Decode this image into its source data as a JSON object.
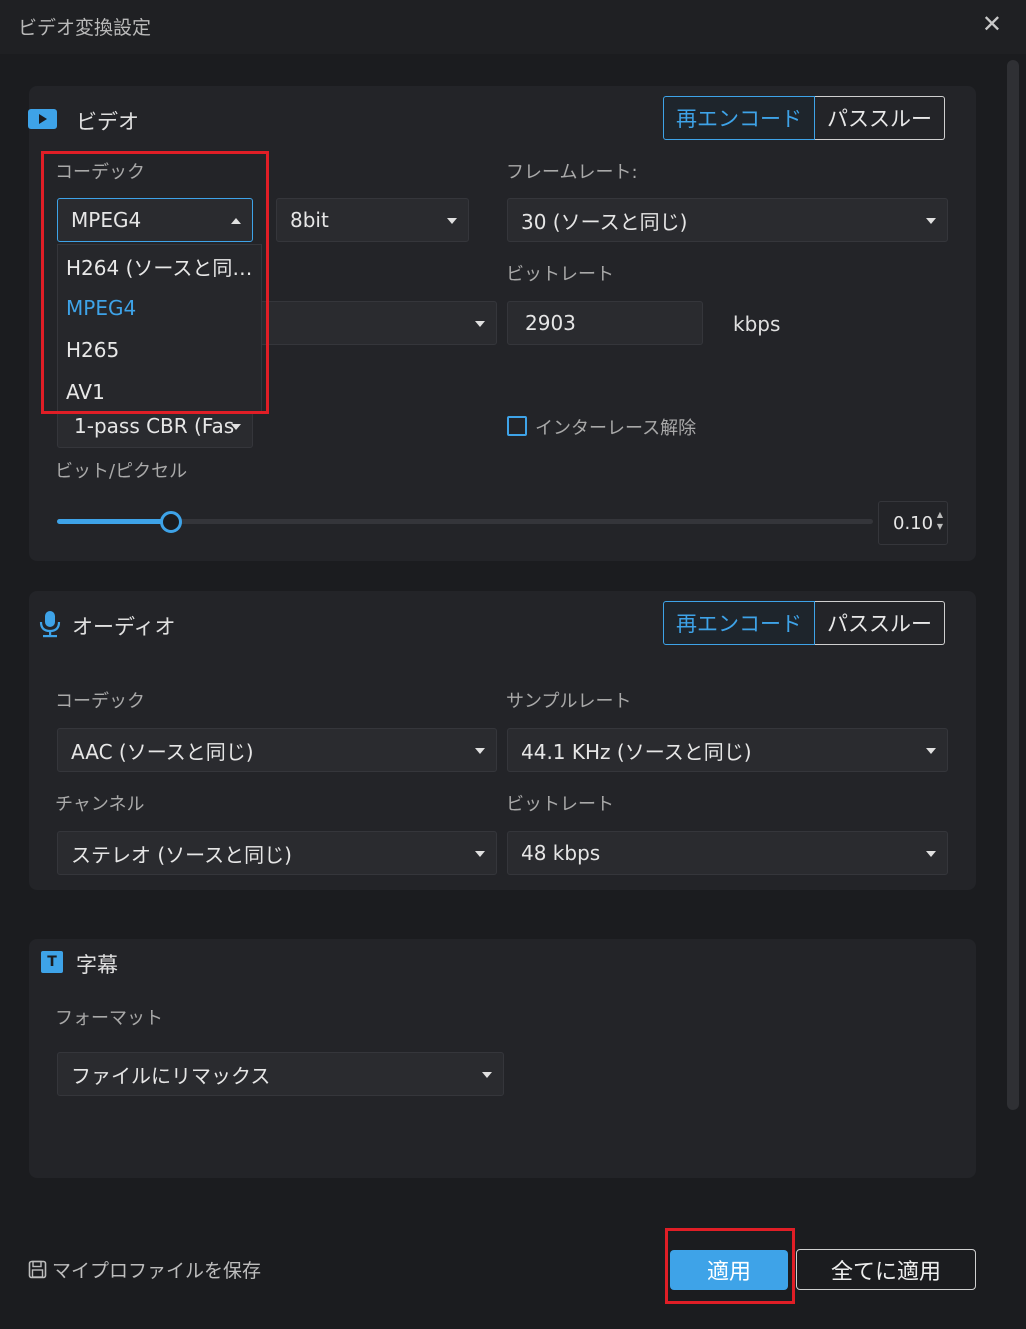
{
  "window": {
    "title": "ビデオ変換設定",
    "close_symbol": "✕"
  },
  "video": {
    "title": "ビデオ",
    "toggle": {
      "reencode": "再エンコード",
      "passthrough": "パススルー",
      "active": "reencode"
    },
    "codec_label": "コーデック",
    "codec_value": "MPEG4",
    "codec_options": [
      "H264 (ソースと同…",
      "MPEG4",
      "H265",
      "AV1"
    ],
    "codec_selected": "MPEG4",
    "bitdepth_value": "8bit",
    "framerate_label": "フレームレート:",
    "framerate_value": "30 (ソースと同じ)",
    "bitrate_label": "ビットレート",
    "bitrate_value": "2903",
    "bitrate_unit": "kbps",
    "encode_mode_value": "1-pass CBR (Fas",
    "deinterlace_label": "インターレース解除",
    "deinterlace_checked": false,
    "bits_per_pixel_label": "ビット/ピクセル",
    "bits_per_pixel_value": "0.10",
    "bits_per_pixel_fraction": 0.14
  },
  "audio": {
    "title": "オーディオ",
    "toggle": {
      "reencode": "再エンコード",
      "passthrough": "パススルー",
      "active": "reencode"
    },
    "codec_label": "コーデック",
    "codec_value": "AAC (ソースと同じ)",
    "samplerate_label": "サンプルレート",
    "samplerate_value": "44.1 KHz (ソースと同じ)",
    "channel_label": "チャンネル",
    "channel_value": "ステレオ (ソースと同じ)",
    "bitrate_label": "ビットレート",
    "bitrate_value": "48 kbps"
  },
  "subtitle": {
    "title": "字幕",
    "format_label": "フォーマット",
    "format_value": "ファイルにリマックス",
    "icon_letter": "T"
  },
  "footer": {
    "save_profile": "マイプロファイルを保存",
    "apply": "適用",
    "apply_all": "全てに適用"
  },
  "colors": {
    "accent": "#3ea3e8",
    "highlight": "#e01e26",
    "background": "#1b1c1f",
    "panel": "#232428"
  }
}
